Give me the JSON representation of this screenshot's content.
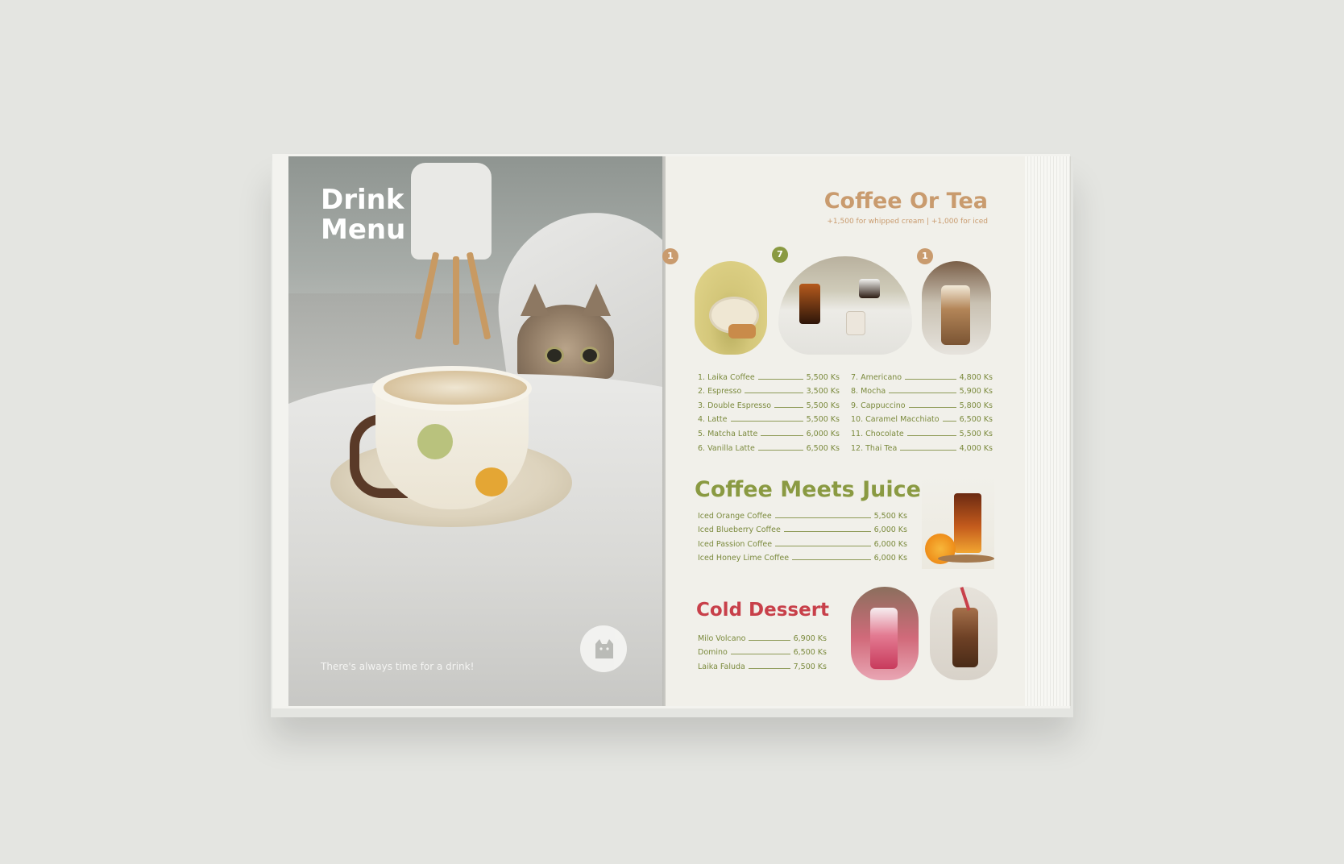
{
  "left_page": {
    "title_line1": "Drink",
    "title_line2": "Menu",
    "tagline": "There's always time for a drink!"
  },
  "coffee_tea": {
    "title": "Coffee Or Tea",
    "subtitle": "+1,500 for whipped cream | +1,000 for iced",
    "badges": [
      "1",
      "7",
      "1"
    ],
    "badge_colors": [
      "#c99b6e",
      "#8a9a42",
      "#c99b6e"
    ],
    "items_left": [
      {
        "name": "1. Laika Coffee",
        "price": "5,500  Ks"
      },
      {
        "name": "2. Espresso",
        "price": "3,500  Ks"
      },
      {
        "name": "3. Double Espresso",
        "price": "5,500  Ks"
      },
      {
        "name": "4. Latte",
        "price": "5,500  Ks"
      },
      {
        "name": "5. Matcha Latte",
        "price": "6,000  Ks"
      },
      {
        "name": "6. Vanilla Latte",
        "price": "6,500  Ks"
      }
    ],
    "items_right": [
      {
        "name": "7. Americano",
        "price": "4,800  Ks"
      },
      {
        "name": "8. Mocha",
        "price": "5,900  Ks"
      },
      {
        "name": "9. Cappuccino",
        "price": "5,800  Ks"
      },
      {
        "name": "10. Caramel Macchiato",
        "price": "6,500  Ks"
      },
      {
        "name": "11. Chocolate",
        "price": "5,500  Ks"
      },
      {
        "name": "12. Thai Tea",
        "price": "4,000  Ks"
      }
    ]
  },
  "coffee_juice": {
    "title": "Coffee Meets Juice",
    "items": [
      {
        "name": "Iced Orange Coffee",
        "price": "5,500  Ks"
      },
      {
        "name": "Iced Blueberry Coffee",
        "price": "6,000  Ks"
      },
      {
        "name": "Iced Passion Coffee",
        "price": "6,000  Ks"
      },
      {
        "name": "Iced Honey Lime Coffee",
        "price": "6,000  Ks"
      }
    ]
  },
  "cold_dessert": {
    "title": "Cold Dessert",
    "items": [
      {
        "name": "Milo Volcano",
        "price": "6,900 Ks"
      },
      {
        "name": "Domino",
        "price": "6,500 Ks"
      },
      {
        "name": "Laika Faluda",
        "price": "7,500 Ks"
      }
    ]
  },
  "colors": {
    "background": "#e4e5e1",
    "coffee_tan": "#c99b6e",
    "olive_green": "#8a9a42",
    "dessert_red": "#c8404a"
  }
}
